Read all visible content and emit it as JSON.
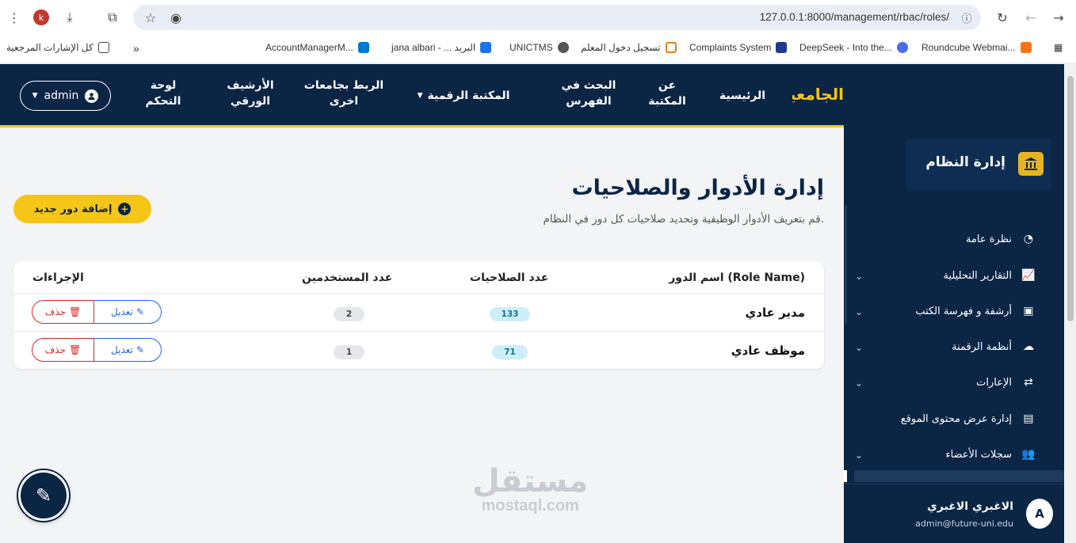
{
  "browser": {
    "url": "127.0.0.1:8000/management/rbac/roles/",
    "profile_initial": "k",
    "bookmarks": [
      "كل الإشارات المرجعية",
      "AccountManagerM...",
      "jana albari - ... البريد",
      "UNICTMS",
      "تسجيل دخول المعلم",
      "Complaints System",
      "DeepSeek - Into the...",
      "Roundcube Webmai..."
    ]
  },
  "topnav": {
    "brand": "الجامعية",
    "items": [
      "الرئيسية",
      "عن المكتبة",
      "البحث في الفهرس",
      "المكتبة الرقمية",
      "الربط بجامعات اخرى",
      "الأرشيف الورقي",
      "لوحة التحكم"
    ],
    "admin_label": "admin"
  },
  "sidebar": {
    "title": "إدارة النظام",
    "items": [
      {
        "label": "نظرة عامة",
        "icon": "pie-chart-icon"
      },
      {
        "label": "التقارير التحليلية",
        "icon": "line-chart-icon"
      },
      {
        "label": "أرشفة و فهرسة الكتب",
        "icon": "book-icon"
      },
      {
        "label": "أنظمة الرقمنة",
        "icon": "cloud-upload-icon"
      },
      {
        "label": "الإعارات",
        "icon": "exchange-icon"
      },
      {
        "label": "إدارة عرض محتوى الموقع",
        "icon": "image-icon"
      },
      {
        "label": "سجلات الأعضاء",
        "icon": "users-icon"
      }
    ],
    "user": {
      "initial": "A",
      "name": "الاغبري الاغبري",
      "email": "admin@future-uni.edu"
    }
  },
  "main": {
    "title": "إدارة الأدوار والصلاحيات",
    "subtitle": "قم بتعريف الأدوار الوظيفية وتحديد صلاحيات كل دور في النظام.",
    "add_button": "إضافة دور جديد",
    "table": {
      "headers": [
        "اسم الدور (Role Name)",
        "عدد الصلاحيات",
        "عدد المستخدمين",
        "الإجراءات"
      ],
      "rows": [
        {
          "name": "مدير عادي",
          "permissions": "133",
          "users": "2",
          "edit": "تعديل",
          "delete": "حذف"
        },
        {
          "name": "موظف عادي",
          "permissions": "71",
          "users": "1",
          "edit": "تعديل",
          "delete": "حذف"
        }
      ]
    }
  },
  "watermark": {
    "arabic": "مستقل",
    "latin": "mostaql.com"
  },
  "colors": {
    "navy": "#0b2545",
    "gold": "#f5c518",
    "danger": "#dc2626",
    "primary": "#2563eb"
  }
}
